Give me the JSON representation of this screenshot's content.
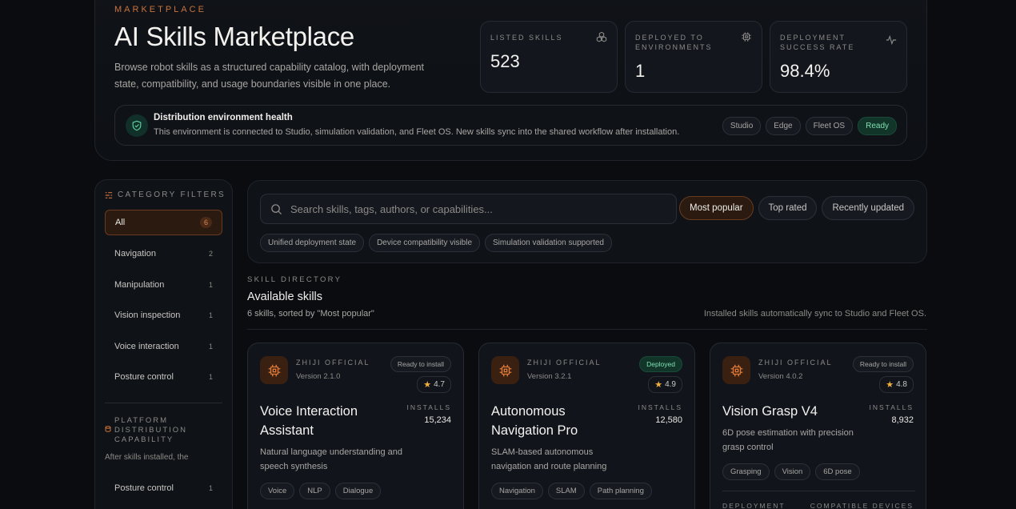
{
  "header": {
    "eyebrow": "MARKETPLACE",
    "title": "AI Skills Marketplace",
    "subtitle": "Browse robot skills as a structured capability catalog, with deployment state, compatibility, and usage boundaries visible in one place."
  },
  "stats": [
    {
      "label": "LISTED SKILLS",
      "value": "523",
      "icon": "cubes-icon"
    },
    {
      "label": "DEPLOYED TO ENVIRONMENTS",
      "value": "1",
      "icon": "chip-icon"
    },
    {
      "label": "DEPLOYMENT SUCCESS RATE",
      "value": "98.4%",
      "icon": "pulse-icon"
    }
  ],
  "health": {
    "title": "Distribution environment health",
    "description": "This environment is connected to Studio, simulation validation, and Fleet OS. New skills sync into the shared workflow after installation.",
    "pills": [
      "Studio",
      "Edge",
      "Fleet OS",
      "Ready"
    ]
  },
  "sidebar": {
    "heading": "CATEGORY FILTERS",
    "categories": [
      {
        "label": "All",
        "count": "6"
      },
      {
        "label": "Navigation",
        "count": "2"
      },
      {
        "label": "Manipulation",
        "count": "1"
      },
      {
        "label": "Vision inspection",
        "count": "1"
      },
      {
        "label": "Voice interaction",
        "count": "1"
      },
      {
        "label": "Posture control",
        "count": "1"
      }
    ],
    "platform_heading": "PLATFORM DISTRIBUTION CAPABILITY",
    "platform_text": "After skills installed, the",
    "extra_category": {
      "label": "Posture control",
      "count": "1"
    }
  },
  "search": {
    "placeholder": "Search skills, tags, authors, or capabilities...",
    "value": "",
    "sort_options": [
      "Most popular",
      "Top rated",
      "Recently updated"
    ],
    "active_sort": "Most popular",
    "tags": [
      "Unified deployment state",
      "Device compatibility visible",
      "Simulation validation supported"
    ]
  },
  "directory": {
    "eyebrow": "SKILL DIRECTORY",
    "title": "Available skills",
    "subtitle": "6 skills, sorted by \"Most popular\"",
    "note": "Installed skills automatically sync to Studio and Fleet OS."
  },
  "skills": [
    {
      "vendor": "ZHIJI OFFICIAL",
      "version": "Version 2.1.0",
      "status": "Ready to install",
      "rating": "4.7",
      "name": "Voice Interaction Assistant",
      "installs_label": "INSTALLS",
      "installs": "15,234",
      "description": "Natural language understanding and speech synthesis",
      "tags": [
        "Voice",
        "NLP",
        "Dialogue"
      ]
    },
    {
      "vendor": "ZHIJI OFFICIAL",
      "version": "Version 3.2.1",
      "status": "Deployed",
      "rating": "4.9",
      "name": "Autonomous Navigation Pro",
      "installs_label": "INSTALLS",
      "installs": "12,580",
      "description": "SLAM-based autonomous navigation and route planning",
      "tags": [
        "Navigation",
        "SLAM",
        "Path planning"
      ]
    },
    {
      "vendor": "ZHIJI OFFICIAL",
      "version": "Version 4.0.2",
      "status": "Ready to install",
      "rating": "4.8",
      "name": "Vision Grasp V4",
      "installs_label": "INSTALLS",
      "installs": "8,932",
      "description": "6D pose estimation with precision grasp control",
      "tags": [
        "Grasping",
        "Vision",
        "6D pose"
      ],
      "deployment_label": "DEPLOYMENT",
      "compat_label": "COMPATIBLE DEVICES"
    }
  ],
  "colors": {
    "accent": "#c9733c",
    "ready": "#7fe0b2",
    "background": "#0a0c10"
  }
}
